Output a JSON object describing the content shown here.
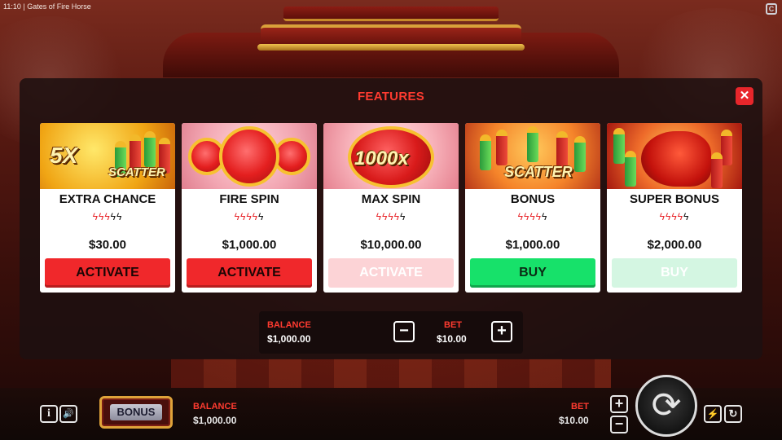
{
  "status_bar": {
    "time_title": "11:10 | Gates of Fire Horse"
  },
  "modal": {
    "title": "FEATURES",
    "close_symbol": "✕",
    "cards": [
      {
        "name": "EXTRA CHANCE",
        "bolts_on": 3,
        "bolts_total": 5,
        "price": "$30.00",
        "button": "ACTIVATE",
        "button_state": "enabled",
        "art_text": "5X",
        "art_subtext": "SCATTER"
      },
      {
        "name": "FIRE SPIN",
        "bolts_on": 4,
        "bolts_total": 5,
        "price": "$1,000.00",
        "button": "ACTIVATE",
        "button_state": "enabled"
      },
      {
        "name": "MAX SPIN",
        "bolts_on": 4,
        "bolts_total": 5,
        "price": "$10,000.00",
        "button": "ACTIVATE",
        "button_state": "disabled",
        "art_text": "1000x"
      },
      {
        "name": "BONUS",
        "bolts_on": 4,
        "bolts_total": 5,
        "price": "$1,000.00",
        "button": "BUY",
        "button_state": "enabled",
        "art_text": "SCATTER"
      },
      {
        "name": "SUPER BONUS",
        "bolts_on": 4,
        "bolts_total": 5,
        "price": "$2,000.00",
        "button": "BUY",
        "button_state": "disabled"
      }
    ],
    "balance_label": "BALANCE",
    "balance_value": "$1,000.00",
    "bet_label": "BET",
    "bet_value": "$10.00",
    "minus_symbol": "−",
    "plus_symbol": "+"
  },
  "hud": {
    "info_symbol": "i",
    "sound_symbol": "🔊",
    "bonus_label": "BONUS",
    "balance_label": "BALANCE",
    "balance_value": "$1,000.00",
    "bet_label": "BET",
    "bet_value": "$10.00",
    "plus_symbol": "+",
    "minus_symbol": "−",
    "spin_symbol": "⟳",
    "turbo_symbol": "⚡",
    "autoplay_symbol": "↻"
  },
  "colors": {
    "accent_red": "#ff3b30",
    "activate_red": "#f0282b",
    "buy_green": "#17e16a",
    "close_red": "#e8262b"
  },
  "icons": [
    "close-icon",
    "lightning-bolt-icon",
    "minus-icon",
    "plus-icon",
    "info-icon",
    "sound-icon",
    "spin-icon",
    "turbo-icon",
    "autoplay-icon"
  ]
}
